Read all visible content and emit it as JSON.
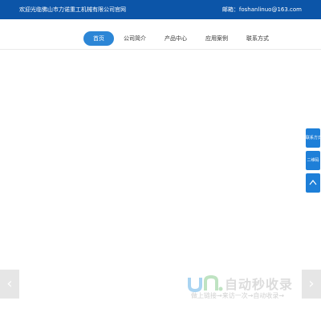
{
  "topbar": {
    "welcome": "欢迎光临佛山市力诺重工机械有限公司官网",
    "email": "邮箱：foshanlinuo@163.com"
  },
  "nav": {
    "items": [
      {
        "label": "首页",
        "active": true
      },
      {
        "label": "公司简介",
        "active": false
      },
      {
        "label": "产品中心",
        "active": false
      },
      {
        "label": "应用案例",
        "active": false
      },
      {
        "label": "联系方式",
        "active": false
      }
    ]
  },
  "side_widget": {
    "contact_label": "联系方式",
    "qrcode_label": "二维码",
    "top_icon": "chevron-up-icon"
  },
  "slider": {
    "prev_icon": "chevron-left-icon",
    "next_icon": "chevron-right-icon",
    "prev_glyph": "‹",
    "next_glyph": "›"
  },
  "watermark": {
    "title": "自动秒收录",
    "subtitle": "做上链接→来访一次→自动收录→"
  },
  "colors": {
    "topbar": "#0c55a8",
    "active_nav": "#2c86d6",
    "side_button": "#1e7fd8"
  }
}
